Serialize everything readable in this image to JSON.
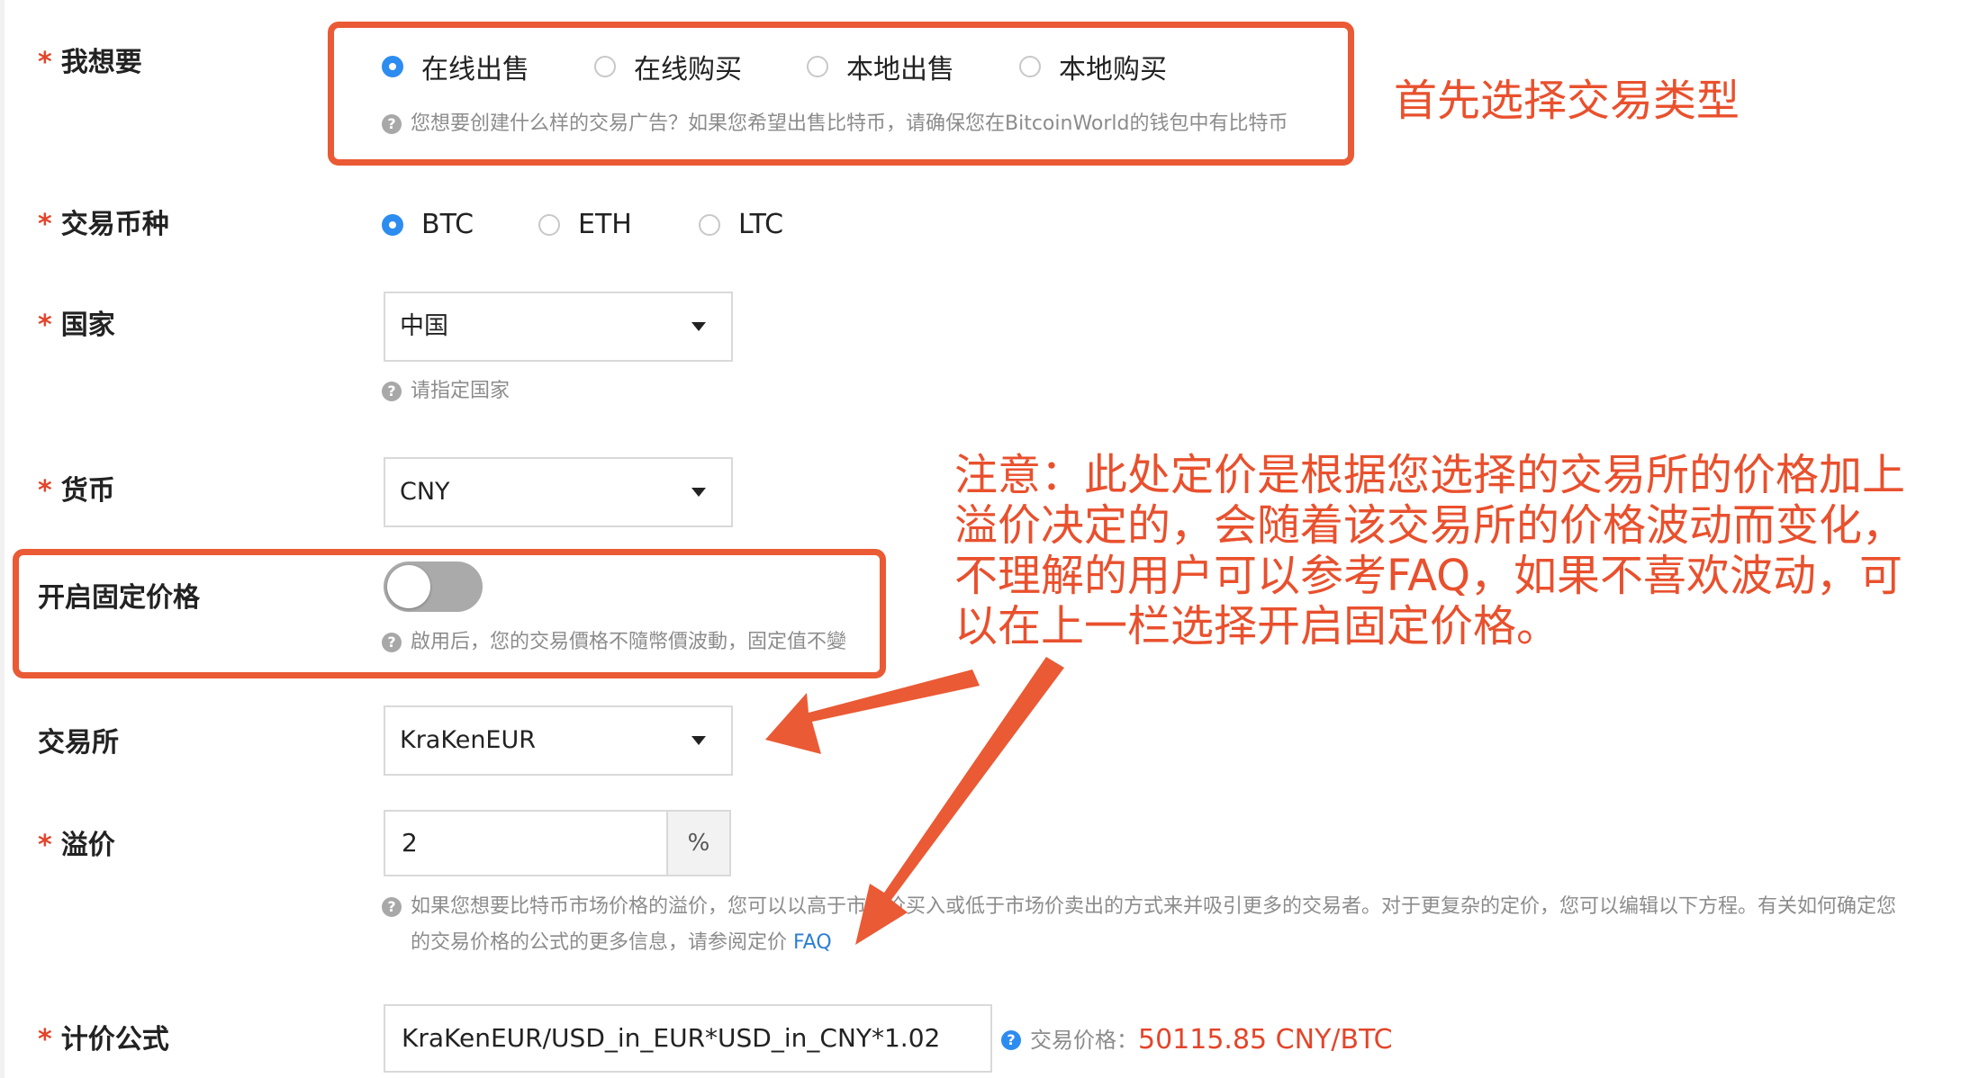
{
  "form": {
    "want": {
      "label": "我想要",
      "options": [
        "在线出售",
        "在线购买",
        "本地出售",
        "本地购买"
      ],
      "selected_index": 0,
      "hint": "您想要创建什么样的交易广告？如果您希望出售比特币，请确保您在BitcoinWorld的钱包中有比特币"
    },
    "coin": {
      "label": "交易币种",
      "options": [
        "BTC",
        "ETH",
        "LTC"
      ],
      "selected_index": 0
    },
    "country": {
      "label": "国家",
      "value": "中国",
      "hint": "请指定国家"
    },
    "currency": {
      "label": "货币",
      "value": "CNY"
    },
    "fixed_price": {
      "label": "开启固定价格",
      "enabled": false,
      "hint": "啟用后，您的交易價格不隨幣價波動，固定值不變"
    },
    "exchange": {
      "label": "交易所",
      "value": "KraKenEUR"
    },
    "premium": {
      "label": "溢价",
      "value": "2",
      "unit": "%",
      "hint_line1": "如果您想要比特币市场价格的溢价，您可以以高于市场价买入或低于市场价卖出的方式来并吸引更多的交易者。对于更复杂的定价，您可以编辑以下方程。有关如何确定您",
      "hint_line2": "的交易价格的公式的更多信息，请参阅定价",
      "faq_link": "FAQ"
    },
    "formula": {
      "label": "计价公式",
      "value": "KraKenEUR/USD_in_EUR*USD_in_CNY*1.02",
      "price_label": "交易价格：",
      "price_value": "50115.85 CNY/BTC"
    },
    "required_mark": "*"
  },
  "annotations": {
    "step1": "首先选择交易类型",
    "note_lines": [
      "注意：此处定价是根据您选择的交易所的价格加上",
      "溢价决定的，会随着该交易所的价格波动而变化，",
      "不理解的用户可以参考FAQ，如果不喜欢波动，可",
      "以在上一栏选择开启固定价格。"
    ]
  },
  "colors": {
    "annotation_red": "#ea5a35",
    "radio_blue": "#2d8cf0",
    "price_red": "#e3452b",
    "link_blue": "#2d7ed6"
  },
  "icons": [
    "question-icon",
    "caret-down-icon",
    "arrow-icon"
  ]
}
